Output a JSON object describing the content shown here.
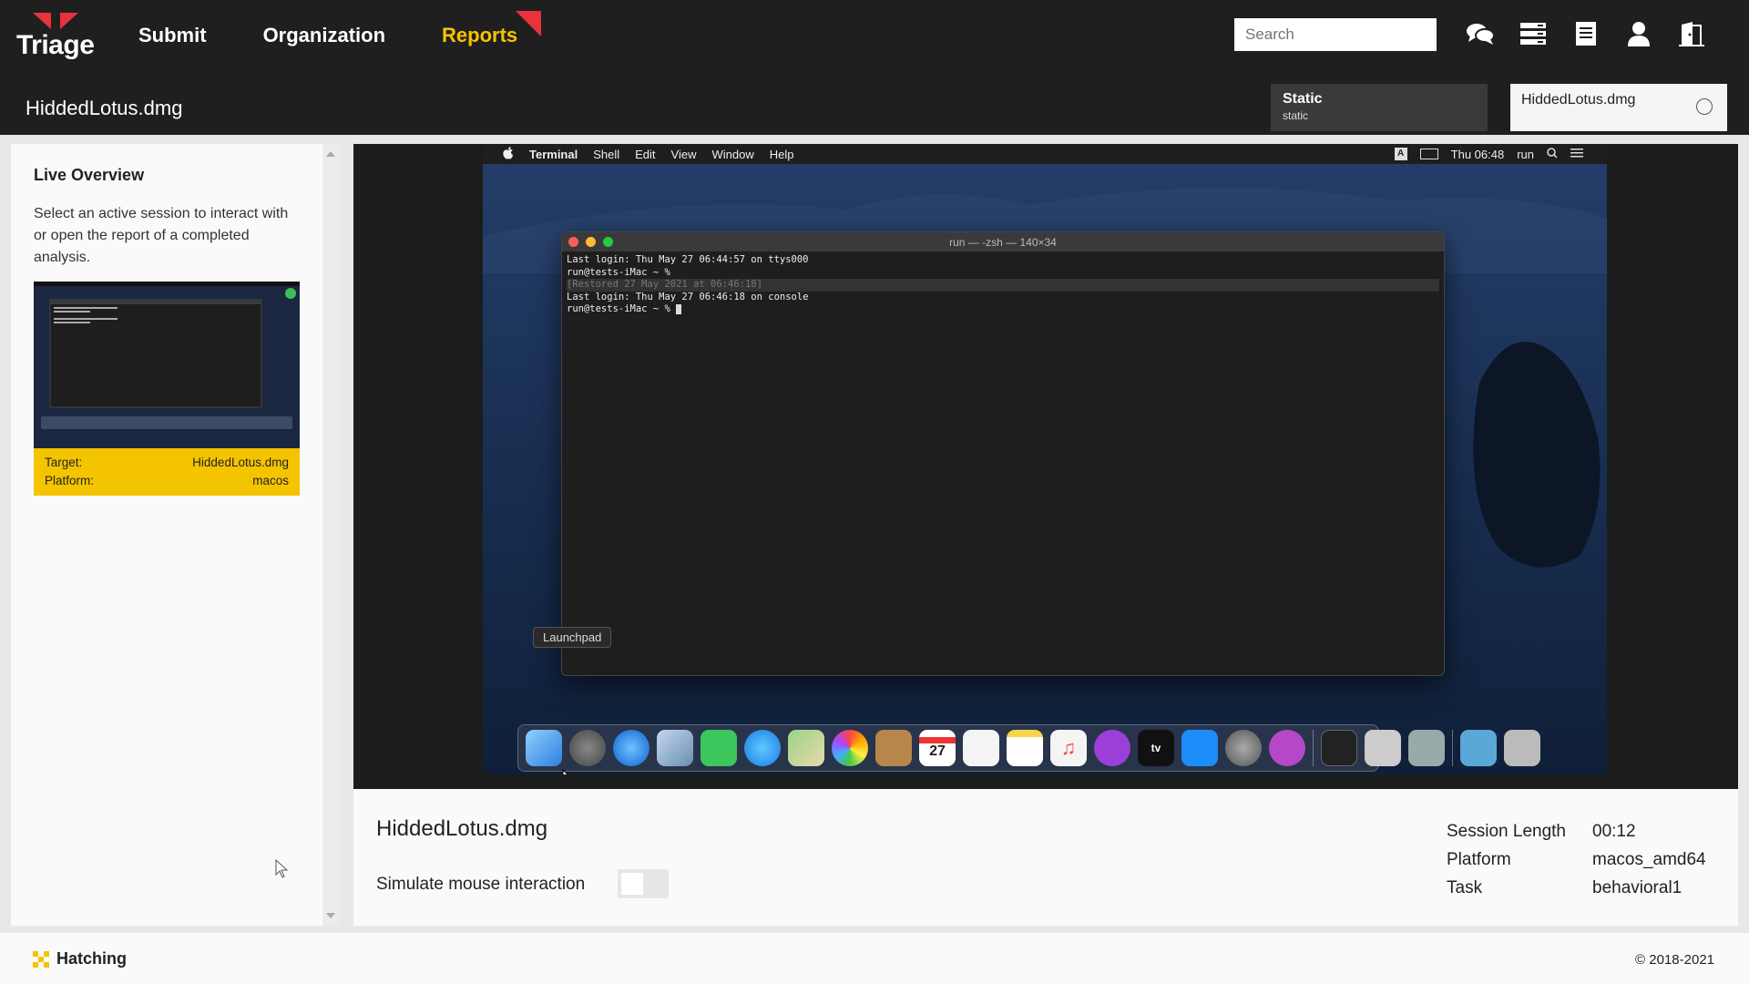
{
  "header": {
    "logo_text": "Triage",
    "nav": [
      {
        "label": "Submit"
      },
      {
        "label": "Organization"
      },
      {
        "label": "Reports"
      }
    ],
    "search_placeholder": "Search",
    "page_title": "HiddedLotus.dmg",
    "tabs": {
      "static_title": "Static",
      "static_sub": "static",
      "file_title": "HiddedLotus.dmg"
    },
    "icons": [
      "chat-icon",
      "server-icon",
      "document-icon",
      "user-icon",
      "logout-icon"
    ]
  },
  "left_panel": {
    "title": "Live Overview",
    "description": "Select an active session to interact with or open the report of a completed analysis.",
    "card": {
      "target_label": "Target:",
      "target_value": "HiddedLotus.dmg",
      "platform_label": "Platform:",
      "platform_value": "macos"
    }
  },
  "vm": {
    "menubar": {
      "app": "Terminal",
      "items": [
        "Shell",
        "Edit",
        "View",
        "Window",
        "Help"
      ],
      "clock": "Thu 06:48",
      "user": "run"
    },
    "terminal": {
      "title": "run — -zsh — 140×34",
      "lines": [
        "Last login: Thu May 27 06:44:57 on ttys000",
        "run@tests-iMac ~ %",
        "  [Restored 27 May 2021 at 06:46:18]",
        "Last login: Thu May 27 06:46:18 on console",
        "run@tests-iMac ~ % "
      ]
    },
    "tooltip": "Launchpad",
    "calendar_day": "27",
    "tv_label": "tv"
  },
  "info": {
    "title": "HiddedLotus.dmg",
    "simulate_label": "Simulate mouse interaction",
    "session_length_label": "Session Length",
    "session_length_value": "00:12",
    "platform_label": "Platform",
    "platform_value": "macos_amd64",
    "task_label": "Task",
    "task_value": "behavioral1"
  },
  "footer": {
    "brand": "Hatching",
    "copyright": "© 2018-2021"
  },
  "colors": {
    "accent": "#f5c400",
    "brand_red": "#e8323c",
    "topbar": "#1f1f1f"
  }
}
